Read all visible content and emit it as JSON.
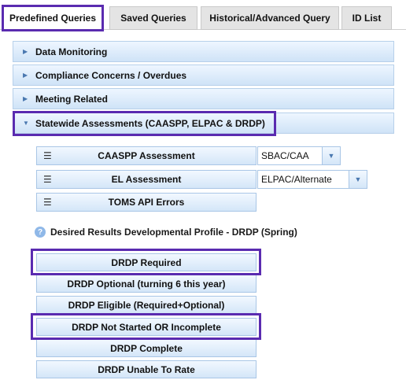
{
  "tabs": [
    {
      "label": "Predefined Queries"
    },
    {
      "label": "Saved Queries"
    },
    {
      "label": "Historical/Advanced Query"
    },
    {
      "label": "ID List"
    }
  ],
  "panels": [
    {
      "label": "Data Monitoring"
    },
    {
      "label": "Compliance Concerns / Overdues"
    },
    {
      "label": "Meeting Related"
    },
    {
      "label": "Statewide Assessments (CAASPP, ELPAC & DRDP)"
    }
  ],
  "assessments": [
    {
      "label": "CAASPP Assessment",
      "select_value": "SBAC/CAA"
    },
    {
      "label": "EL Assessment",
      "select_value": "ELPAC/Alternate"
    },
    {
      "label": "TOMS API Errors"
    }
  ],
  "drdp": {
    "heading": "Desired Results Developmental Profile - DRDP (Spring)",
    "buttons": [
      {
        "label": "DRDP Required"
      },
      {
        "label": "DRDP Optional (turning 6 this year)"
      },
      {
        "label": "DRDP Eligible (Required+Optional)"
      },
      {
        "label": "DRDP Not Started OR Incomplete"
      },
      {
        "label": "DRDP Complete"
      },
      {
        "label": "DRDP Unable To Rate"
      }
    ]
  },
  "icons": {
    "collapsed": "caret-right-icon",
    "expanded": "caret-down-icon",
    "list": "list-icon",
    "help": "help-icon",
    "dropdown": "chevron-down-icon"
  },
  "colors": {
    "highlight": "#5a2bb0",
    "panel_border": "#b7d0ea",
    "accent": "#4a78b0"
  }
}
